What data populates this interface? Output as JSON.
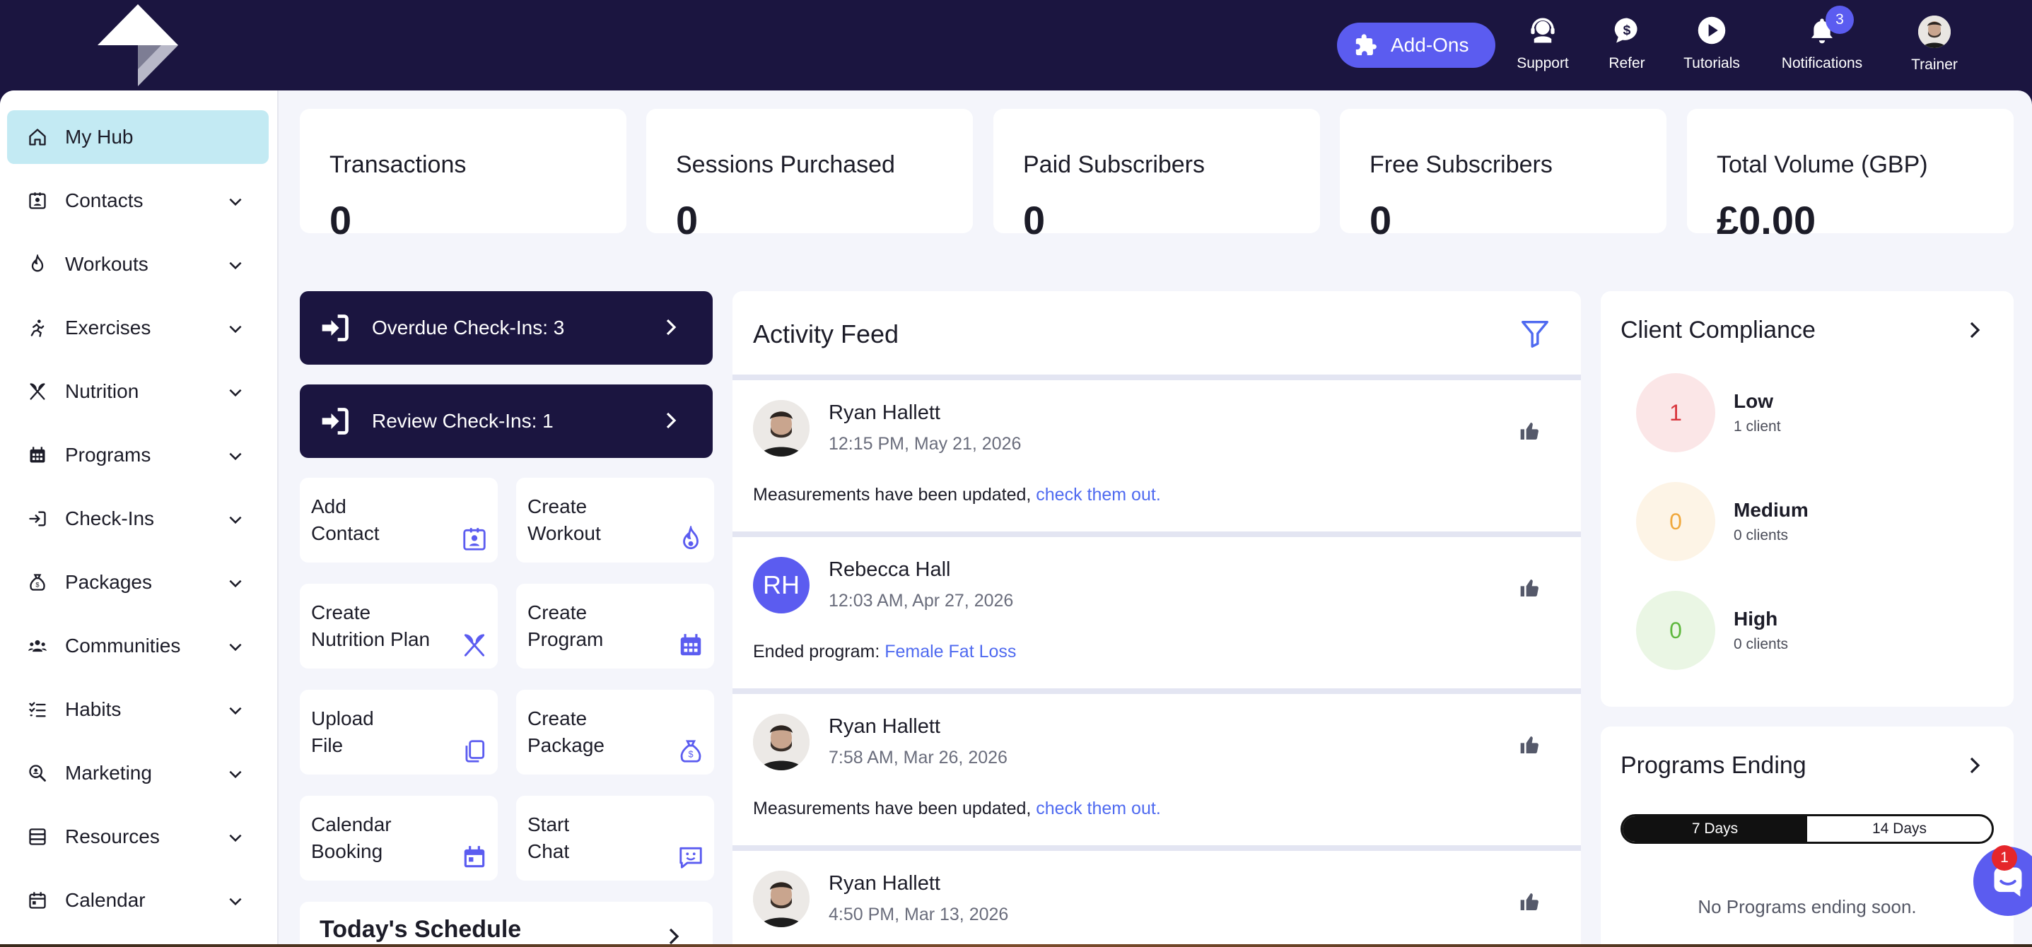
{
  "topbar": {
    "addons_label": "Add-Ons",
    "nav": [
      {
        "label": "Support",
        "icon": "support-headset-icon"
      },
      {
        "label": "Refer",
        "icon": "dollar-chat-icon"
      },
      {
        "label": "Tutorials",
        "icon": "play-icon"
      },
      {
        "label": "Notifications",
        "icon": "bell-icon",
        "badge": "3"
      },
      {
        "label": "Trainer",
        "icon": "avatar"
      }
    ]
  },
  "sidebar": {
    "items": [
      {
        "label": "My Hub",
        "icon": "home-icon",
        "active": true
      },
      {
        "label": "Contacts",
        "icon": "contact-card-icon"
      },
      {
        "label": "Workouts",
        "icon": "flame-icon"
      },
      {
        "label": "Exercises",
        "icon": "running-icon"
      },
      {
        "label": "Nutrition",
        "icon": "utensils-icon"
      },
      {
        "label": "Programs",
        "icon": "calendar-grid-icon"
      },
      {
        "label": "Check-Ins",
        "icon": "sign-in-icon"
      },
      {
        "label": "Packages",
        "icon": "money-bag-icon"
      },
      {
        "label": "Communities",
        "icon": "users-icon"
      },
      {
        "label": "Habits",
        "icon": "checklist-icon"
      },
      {
        "label": "Marketing",
        "icon": "search-person-icon"
      },
      {
        "label": "Resources",
        "icon": "database-icon"
      },
      {
        "label": "Calendar",
        "icon": "calendar-icon"
      }
    ]
  },
  "stats": [
    {
      "label": "Transactions",
      "value": "0"
    },
    {
      "label": "Sessions Purchased",
      "value": "0"
    },
    {
      "label": "Paid Subscribers",
      "value": "0"
    },
    {
      "label": "Free Subscribers",
      "value": "0"
    },
    {
      "label": "Total Volume (GBP)",
      "value": "£0.00"
    }
  ],
  "checkins": {
    "overdue": "Overdue Check-Ins: 3",
    "review": "Review Check-Ins: 1"
  },
  "quick_actions": [
    {
      "line1": "Add",
      "line2": "Contact",
      "icon": "contact-card-icon"
    },
    {
      "line1": "Create",
      "line2": "Workout",
      "icon": "flame-icon"
    },
    {
      "line1": "Create",
      "line2": "Nutrition Plan",
      "icon": "utensils-icon"
    },
    {
      "line1": "Create",
      "line2": "Program",
      "icon": "calendar-grid-icon"
    },
    {
      "line1": "Upload",
      "line2": "File",
      "icon": "copy-file-icon"
    },
    {
      "line1": "Create",
      "line2": "Package",
      "icon": "money-bag-icon"
    },
    {
      "line1": "Calendar",
      "line2": "Booking",
      "icon": "calendar-icon"
    },
    {
      "line1": "Start",
      "line2": "Chat",
      "icon": "chat-smile-icon"
    }
  ],
  "schedule_title": "Today's Schedule",
  "feed": {
    "title": "Activity Feed",
    "posts": [
      {
        "name": "Ryan Hallett",
        "date": "12:15 PM, May 21, 2026",
        "text": "Measurements have been updated, ",
        "link": "check them out.",
        "avatar": "photo"
      },
      {
        "name": "Rebecca Hall",
        "date": "12:03 AM, Apr 27, 2026",
        "text": "Ended program: ",
        "link": "Female Fat Loss",
        "avatar": "RH"
      },
      {
        "name": "Ryan Hallett",
        "date": "7:58 AM, Mar 26, 2026",
        "text": "Measurements have been updated, ",
        "link": "check them out.",
        "avatar": "photo"
      },
      {
        "name": "Ryan Hallett",
        "date": "4:50 PM, Mar 13, 2026",
        "text": "",
        "link": "",
        "avatar": "photo"
      }
    ]
  },
  "compliance": {
    "title": "Client Compliance",
    "levels": [
      {
        "count": "1",
        "label": "Low",
        "sub": "1 client",
        "color": "#d9363e",
        "bg": "#fbe6e7"
      },
      {
        "count": "0",
        "label": "Medium",
        "sub": "0 clients",
        "color": "#f0a83c",
        "bg": "#fdf4e6"
      },
      {
        "count": "0",
        "label": "High",
        "sub": "0 clients",
        "color": "#5fb83e",
        "bg": "#eaf6e4"
      }
    ]
  },
  "programs_ending": {
    "title": "Programs Ending",
    "tabs": [
      "7 Days",
      "14 Days"
    ],
    "empty": "No Programs ending soon."
  },
  "chat": {
    "badge": "1"
  },
  "colors": {
    "navy": "#1b1540",
    "accent": "#5b5cf0",
    "active_bg": "#c3eaf3",
    "link": "#4f6af0"
  }
}
